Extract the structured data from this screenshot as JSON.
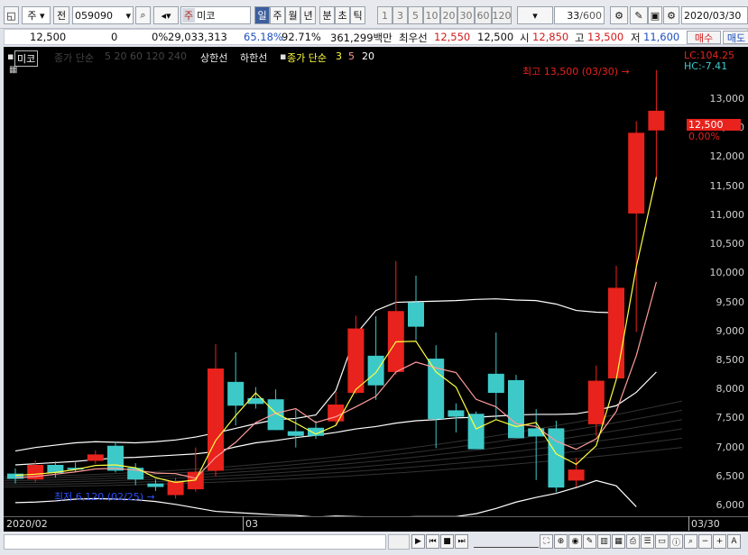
{
  "toolbar": {
    "market": "주",
    "filter": "전",
    "code": "059090",
    "name_prefix": "주",
    "name": "미코",
    "periods": [
      "일",
      "주",
      "월",
      "년",
      "분",
      "초",
      "틱"
    ],
    "intervals": [
      "1",
      "3",
      "5",
      "10",
      "20",
      "30",
      "60",
      "120"
    ],
    "count": "33",
    "count_max": "/600",
    "date": "2020/03/30"
  },
  "info": {
    "price": "12,500",
    "change": "0",
    "change_rate": "0%",
    "volume": "29,033,313",
    "ratio1": "65.18%",
    "ratio2": "92.71%",
    "amount": "361,299백만",
    "best_label": "최우선",
    "best_ask": "12,550",
    "best_bid": "12,500",
    "open_label": "시",
    "open": "12,850",
    "high_label": "고",
    "high": "13,500",
    "low_label": "저",
    "low": "11,600",
    "buy": "매수",
    "sell": "매도"
  },
  "legend": {
    "name": "미코",
    "ma_label": "종가 단순",
    "ma_periods": [
      "5",
      "20",
      "60",
      "120",
      "240"
    ],
    "upper": "상한선",
    "lower": "하한선",
    "ma2_label": "종가 단순",
    "ma2_periods": [
      "3",
      "5",
      "20"
    ]
  },
  "annotations": {
    "high": "최고 13,500 (03/30)",
    "low": "최저 6,120 (02/25)",
    "lc": "LC:104.25",
    "hc": "HC:-7.41",
    "current": "12,500",
    "current_pct": "0.00%"
  },
  "colors": {
    "up": "#e8221c",
    "down": "#3ec9c9",
    "ma3": "#ffff40",
    "ma5": "#ff9b9b",
    "ma20": "#ffffff"
  },
  "x_labels": {
    "start": "2020/02",
    "mid": "03",
    "end": "03/30"
  },
  "chart_data": {
    "type": "candlestick",
    "ylim": [
      5800,
      13900
    ],
    "yticks": [
      6000,
      6500,
      7000,
      7500,
      8000,
      8500,
      9000,
      9500,
      10000,
      10500,
      11000,
      11500,
      12000,
      12500,
      13000
    ],
    "candles": [
      {
        "o": 6550,
        "h": 6640,
        "l": 6380,
        "c": 6460
      },
      {
        "o": 6450,
        "h": 6780,
        "l": 6400,
        "c": 6700
      },
      {
        "o": 6700,
        "h": 6760,
        "l": 6480,
        "c": 6560
      },
      {
        "o": 6650,
        "h": 6740,
        "l": 6580,
        "c": 6620
      },
      {
        "o": 6770,
        "h": 6950,
        "l": 6720,
        "c": 6880
      },
      {
        "o": 7030,
        "h": 7100,
        "l": 6570,
        "c": 6600
      },
      {
        "o": 6650,
        "h": 6730,
        "l": 6350,
        "c": 6450
      },
      {
        "o": 6380,
        "h": 6450,
        "l": 6250,
        "c": 6320
      },
      {
        "o": 6180,
        "h": 6480,
        "l": 6120,
        "c": 6420
      },
      {
        "o": 6280,
        "h": 7000,
        "l": 6240,
        "c": 6580
      },
      {
        "o": 6600,
        "h": 8780,
        "l": 6500,
        "c": 8360
      },
      {
        "o": 8130,
        "h": 8640,
        "l": 7380,
        "c": 7720
      },
      {
        "o": 7850,
        "h": 8040,
        "l": 7670,
        "c": 7750
      },
      {
        "o": 7830,
        "h": 8000,
        "l": 7300,
        "c": 7300
      },
      {
        "o": 7280,
        "h": 7650,
        "l": 7000,
        "c": 7200
      },
      {
        "o": 7340,
        "h": 7460,
        "l": 7150,
        "c": 7200
      },
      {
        "o": 7450,
        "h": 7960,
        "l": 7390,
        "c": 7740
      },
      {
        "o": 7940,
        "h": 9270,
        "l": 7920,
        "c": 9050
      },
      {
        "o": 8580,
        "h": 9260,
        "l": 7820,
        "c": 8070
      },
      {
        "o": 8300,
        "h": 10210,
        "l": 8250,
        "c": 9350
      },
      {
        "o": 9500,
        "h": 9960,
        "l": 8850,
        "c": 9080
      },
      {
        "o": 8530,
        "h": 8760,
        "l": 6990,
        "c": 7490
      },
      {
        "o": 7640,
        "h": 7760,
        "l": 7260,
        "c": 7530
      },
      {
        "o": 7580,
        "h": 7620,
        "l": 7040,
        "c": 6970
      },
      {
        "o": 8270,
        "h": 8980,
        "l": 7490,
        "c": 7940
      },
      {
        "o": 8160,
        "h": 8250,
        "l": 7160,
        "c": 7160
      },
      {
        "o": 7330,
        "h": 7660,
        "l": 6440,
        "c": 7190
      },
      {
        "o": 7330,
        "h": 7460,
        "l": 6230,
        "c": 6310
      },
      {
        "o": 6430,
        "h": 6820,
        "l": 6320,
        "c": 6620
      },
      {
        "o": 7400,
        "h": 8410,
        "l": 7200,
        "c": 8150
      },
      {
        "o": 8190,
        "h": 10130,
        "l": 8160,
        "c": 9750
      },
      {
        "o": 11030,
        "h": 12620,
        "l": 8990,
        "c": 12420
      },
      {
        "o": 12460,
        "h": 13500,
        "l": 11600,
        "c": 12800
      }
    ],
    "ma3": [
      6520,
      6540,
      6570,
      6620,
      6690,
      6700,
      6650,
      6480,
      6400,
      6440,
      7120,
      7550,
      7940,
      7590,
      7420,
      7230,
      7380,
      8000,
      8290,
      8820,
      8830,
      8300,
      8040,
      7320,
      7480,
      7360,
      7430,
      6890,
      6710,
      7030,
      8170,
      10110,
      11660
    ],
    "ma5": [
      6480,
      6500,
      6540,
      6580,
      6630,
      6640,
      6610,
      6560,
      6550,
      6470,
      6830,
      7090,
      7430,
      7590,
      7670,
      7430,
      7530,
      7700,
      7880,
      8300,
      8470,
      8370,
      8290,
      7830,
      7700,
      7410,
      7360,
      7110,
      6970,
      7150,
      7620,
      8580,
      9850
    ],
    "ma20": [
      6700,
      6720,
      6740,
      6760,
      6790,
      6820,
      6830,
      6850,
      6870,
      6890,
      6930,
      7010,
      7080,
      7120,
      7170,
      7210,
      7260,
      7320,
      7360,
      7420,
      7460,
      7480,
      7510,
      7520,
      7540,
      7560,
      7570,
      7570,
      7580,
      7640,
      7720,
      7950,
      8300
    ],
    "upper": [
      6940,
      7000,
      7040,
      7080,
      7100,
      7090,
      7080,
      7100,
      7130,
      7180,
      7250,
      7330,
      7410,
      7480,
      7500,
      7560,
      7980,
      8950,
      9360,
      9500,
      9510,
      9520,
      9530,
      9550,
      9560,
      9540,
      9530,
      9470,
      9360,
      9330,
      9320,
      null,
      null
    ],
    "lower": [
      6050,
      6060,
      6080,
      6110,
      6120,
      6110,
      6100,
      6070,
      6020,
      5960,
      5900,
      5880,
      5860,
      5840,
      5830,
      5800,
      5820,
      5810,
      5800,
      5800,
      5810,
      5810,
      5810,
      5860,
      5950,
      6060,
      6140,
      6210,
      6310,
      6430,
      6340,
      5980,
      null
    ]
  }
}
